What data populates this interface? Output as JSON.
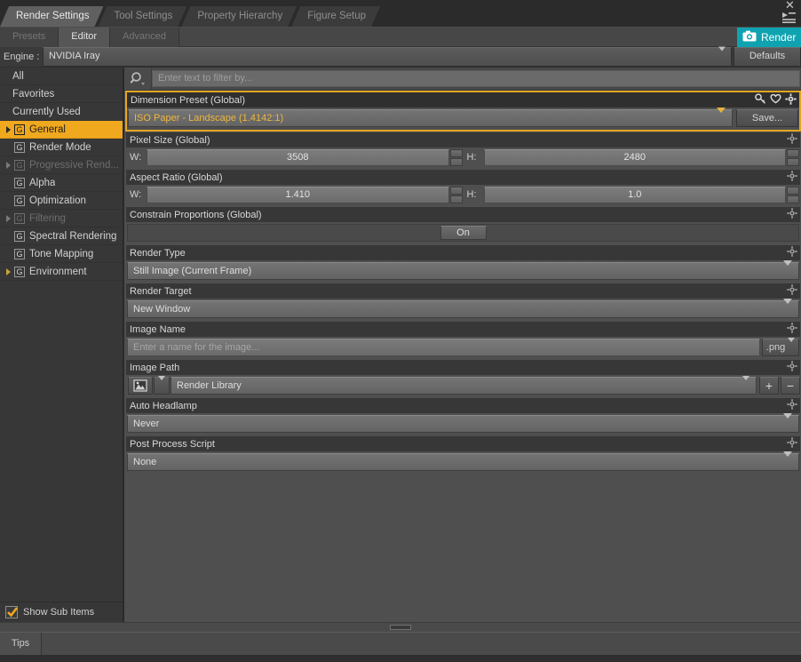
{
  "window": {
    "close_label": "✕",
    "menu_icon": "hamburger-menu-icon"
  },
  "pane_tabs": [
    {
      "label": "Render Settings",
      "active": true
    },
    {
      "label": "Tool Settings",
      "active": false
    },
    {
      "label": "Property Hierarchy",
      "active": false
    },
    {
      "label": "Figure Setup",
      "active": false
    }
  ],
  "sub_tabs": [
    {
      "label": "Presets",
      "active": false,
      "dim": true
    },
    {
      "label": "Editor",
      "active": true,
      "dim": false
    },
    {
      "label": "Advanced",
      "active": false,
      "dim": true
    }
  ],
  "render_button": {
    "label": "Render",
    "icon": "camera-icon",
    "color": "#0fa3b1"
  },
  "engine": {
    "label": "Engine :",
    "value": "NVIDIA Iray",
    "defaults_label": "Defaults"
  },
  "sidebar": {
    "items": [
      {
        "label": "All",
        "twisty": false,
        "gicon": false,
        "selected": false,
        "disabled": false
      },
      {
        "label": "Favorites",
        "twisty": false,
        "gicon": false,
        "selected": false,
        "disabled": false
      },
      {
        "label": "Currently Used",
        "twisty": false,
        "gicon": false,
        "selected": false,
        "disabled": false
      },
      {
        "label": "General",
        "twisty": true,
        "gicon": true,
        "selected": true,
        "disabled": false
      },
      {
        "label": "Render Mode",
        "twisty": false,
        "gicon": true,
        "selected": false,
        "disabled": false
      },
      {
        "label": "Progressive Rend...",
        "twisty": true,
        "gicon": true,
        "selected": false,
        "disabled": true
      },
      {
        "label": "Alpha",
        "twisty": false,
        "gicon": true,
        "selected": false,
        "disabled": false
      },
      {
        "label": "Optimization",
        "twisty": false,
        "gicon": true,
        "selected": false,
        "disabled": false
      },
      {
        "label": "Filtering",
        "twisty": true,
        "gicon": true,
        "selected": false,
        "disabled": true
      },
      {
        "label": "Spectral Rendering",
        "twisty": false,
        "gicon": true,
        "selected": false,
        "disabled": false
      },
      {
        "label": "Tone Mapping",
        "twisty": false,
        "gicon": true,
        "selected": false,
        "disabled": false
      },
      {
        "label": "Environment",
        "twisty": true,
        "gicon": true,
        "selected": false,
        "disabled": false
      }
    ],
    "gicon_letter": "G",
    "show_sub_items_label": "Show Sub Items",
    "show_sub_items_checked": true
  },
  "filter": {
    "placeholder": "Enter text to filter by...",
    "value": "",
    "icon": "search-icon"
  },
  "properties": {
    "dimension_preset": {
      "title": "Dimension Preset (Global)",
      "value": "ISO Paper - Landscape (1.4142:1)",
      "save_label": "Save...",
      "icons": [
        "key-icon",
        "heart-icon",
        "gear-icon"
      ],
      "accent": "#e2a622"
    },
    "pixel_size": {
      "title": "Pixel Size (Global)",
      "w_label": "W:",
      "w_value": "3508",
      "h_label": "H:",
      "h_value": "2480",
      "icons": [
        "gear-icon"
      ]
    },
    "aspect_ratio": {
      "title": "Aspect Ratio (Global)",
      "w_label": "W:",
      "w_value": "1.410",
      "h_label": "H:",
      "h_value": "1.0",
      "icons": [
        "gear-icon"
      ]
    },
    "constrain_proportions": {
      "title": "Constrain Proportions (Global)",
      "value": "On",
      "icons": [
        "gear-icon"
      ]
    },
    "render_type": {
      "title": "Render Type",
      "value": "Still Image (Current Frame)",
      "icons": [
        "gear-icon"
      ]
    },
    "render_target": {
      "title": "Render Target",
      "value": "New Window",
      "icons": [
        "gear-icon"
      ]
    },
    "image_name": {
      "title": "Image Name",
      "placeholder": "Enter a name for the image...",
      "value": "",
      "extension": ".png",
      "icons": [
        "gear-icon"
      ]
    },
    "image_path": {
      "title": "Image Path",
      "value": "Render Library",
      "browse_icon": "picture-icon",
      "add_label": "+",
      "remove_label": "−",
      "icons": [
        "gear-icon"
      ]
    },
    "auto_headlamp": {
      "title": "Auto Headlamp",
      "value": "Never",
      "icons": [
        "gear-icon"
      ]
    },
    "post_process_script": {
      "title": "Post Process Script",
      "value": "None",
      "icons": [
        "gear-icon"
      ]
    }
  },
  "footer": {
    "tips_label": "Tips"
  }
}
